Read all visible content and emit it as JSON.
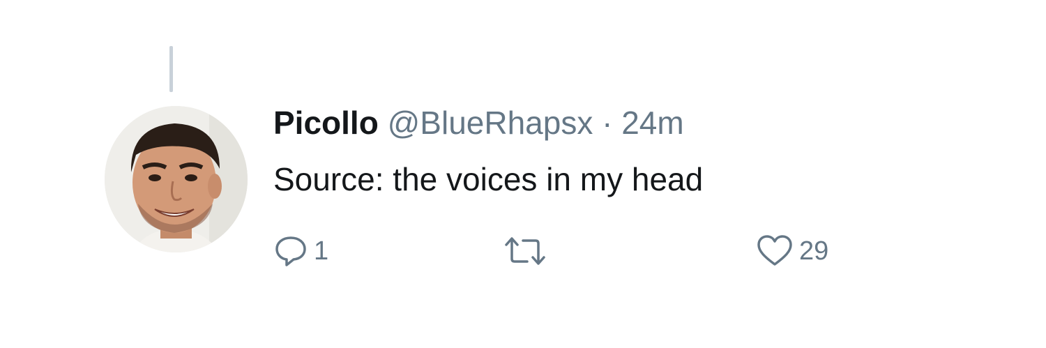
{
  "tweet": {
    "display_name": "Picollo",
    "handle": "@BlueRhapsx",
    "separator": "·",
    "time": "24m",
    "text": "Source: the voices in my head"
  },
  "actions": {
    "reply": {
      "icon": "reply-icon",
      "count": "1"
    },
    "retweet": {
      "icon": "retweet-icon",
      "count": ""
    },
    "like": {
      "icon": "heart-icon",
      "count": "29"
    }
  },
  "colors": {
    "name": "#14171a",
    "secondary": "#657786",
    "thread_line": "#c9d1d9",
    "background": "#ffffff"
  }
}
